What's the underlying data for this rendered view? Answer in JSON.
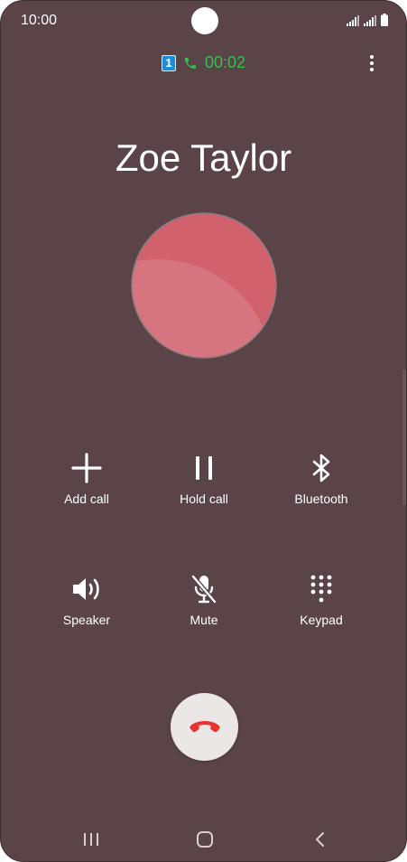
{
  "status_bar": {
    "time": "10:00",
    "icons": [
      "signal-sim1-icon",
      "signal-sim2-icon",
      "battery-icon"
    ]
  },
  "call": {
    "sim_slot": "1",
    "timer": "00:02",
    "contact_name": "Zoe Taylor"
  },
  "actions": {
    "add_call": "Add call",
    "hold_call": "Hold call",
    "bluetooth": "Bluetooth",
    "speaker": "Speaker",
    "mute": "Mute",
    "keypad": "Keypad"
  },
  "navigation": [
    "recent-apps-icon",
    "home-icon",
    "back-icon"
  ],
  "colors": {
    "background": "#5a4448",
    "timer_green": "#2ec24e",
    "sim_blue": "#1c8ed6",
    "avatar": "#d0616d",
    "end_call_red": "#e8332f"
  }
}
